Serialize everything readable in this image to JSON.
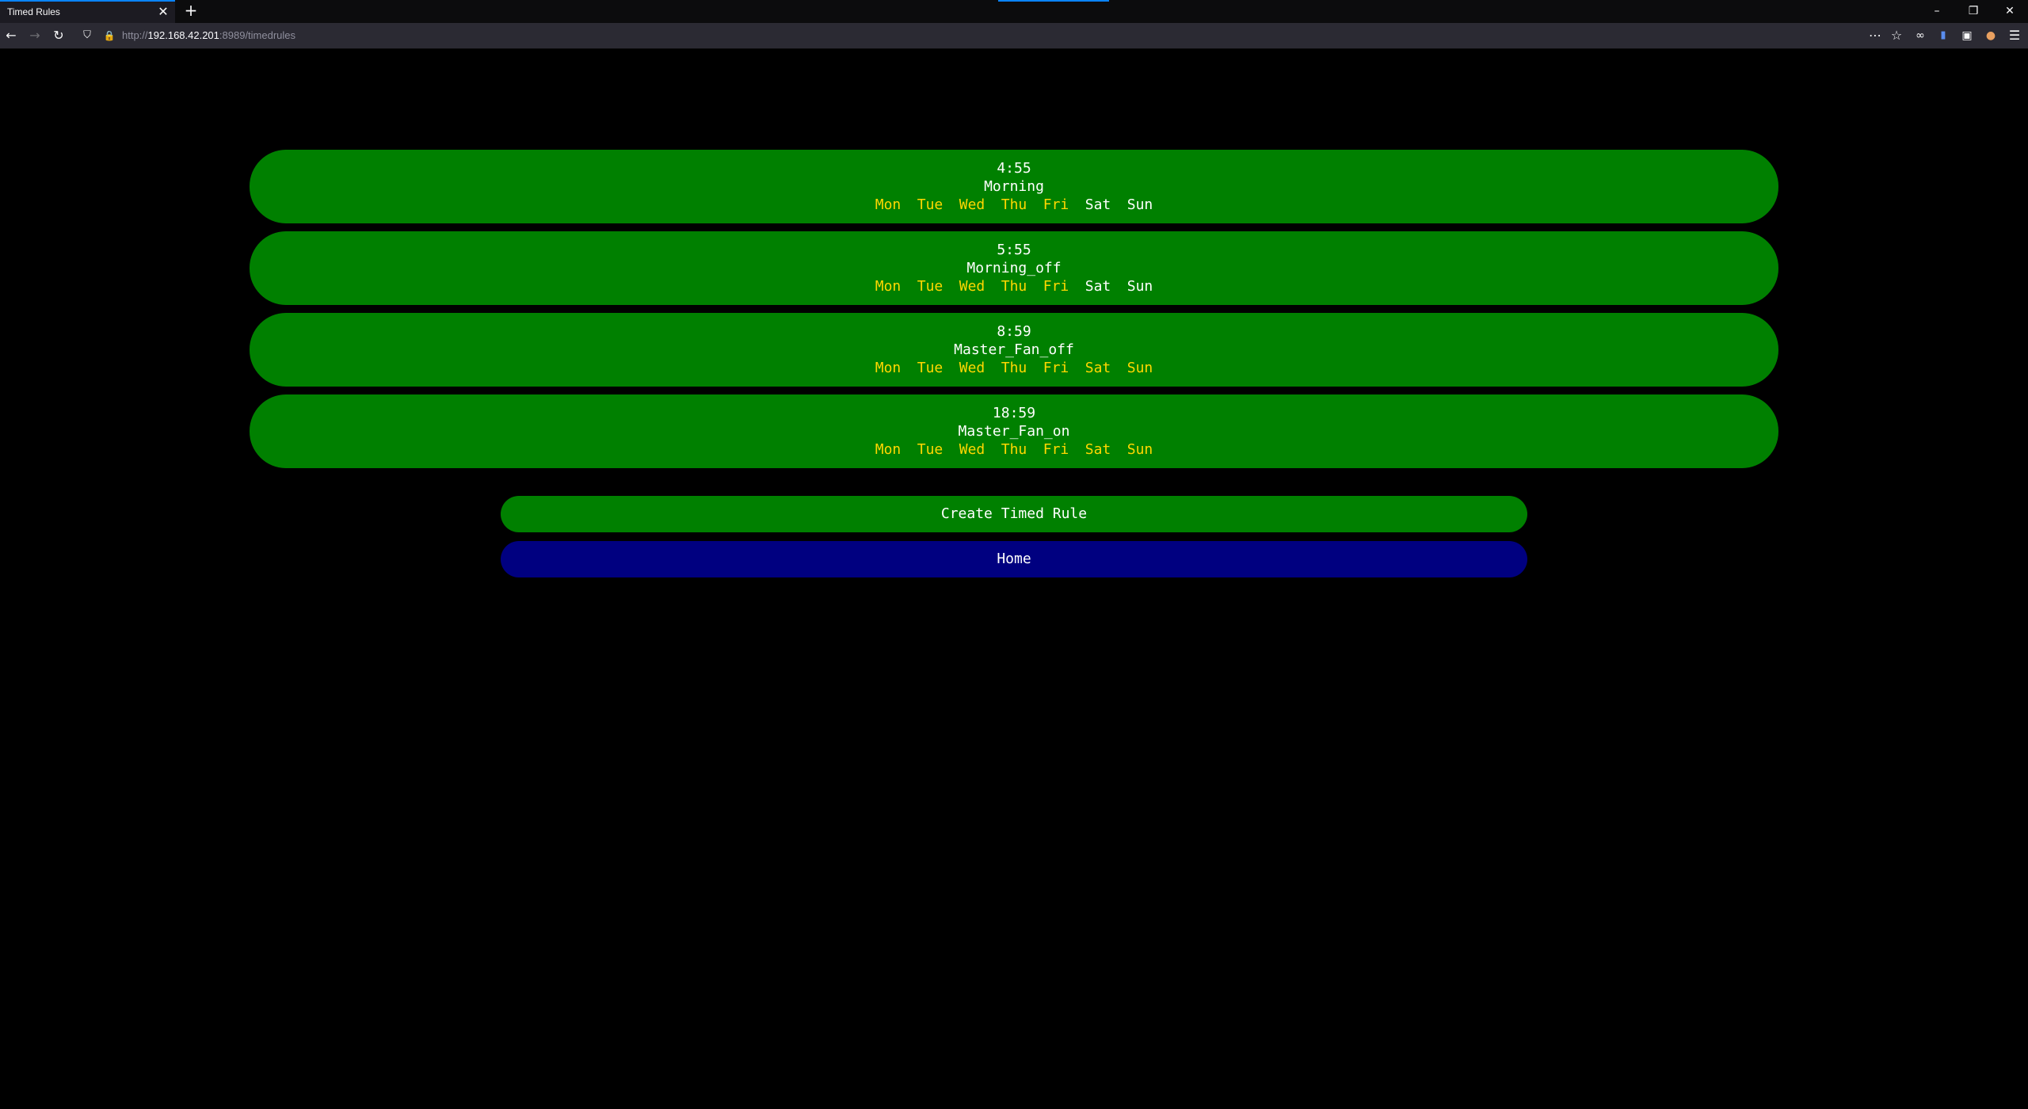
{
  "browser": {
    "tab_title": "Timed Rules",
    "tab_close": "✕",
    "new_tab": "+",
    "url_host": "192.168.42.201",
    "url_scheme": "http://",
    "url_rest": ":8989/timedrules",
    "window_controls": [
      "–",
      "❐",
      "✕"
    ]
  },
  "rules": [
    {
      "time": "4:55",
      "name": "Morning",
      "days": [
        "Mon",
        "Tue",
        "Wed",
        "Thu",
        "Fri",
        "Sat",
        "Sun"
      ],
      "selected": [
        true,
        true,
        true,
        true,
        true,
        false,
        false
      ]
    },
    {
      "time": "5:55",
      "name": "Morning_off",
      "days": [
        "Mon",
        "Tue",
        "Wed",
        "Thu",
        "Fri",
        "Sat",
        "Sun"
      ],
      "selected": [
        true,
        true,
        true,
        true,
        true,
        false,
        false
      ]
    },
    {
      "time": "8:59",
      "name": "Master_Fan_off",
      "days": [
        "Mon",
        "Tue",
        "Wed",
        "Thu",
        "Fri",
        "Sat",
        "Sun"
      ],
      "selected": [
        true,
        true,
        true,
        true,
        true,
        true,
        true
      ]
    },
    {
      "time": "18:59",
      "name": "Master_Fan_on",
      "days": [
        "Mon",
        "Tue",
        "Wed",
        "Thu",
        "Fri",
        "Sat",
        "Sun"
      ],
      "selected": [
        true,
        true,
        true,
        true,
        true,
        true,
        true
      ]
    }
  ],
  "actions": {
    "create_label": "Create Timed Rule",
    "home_label": "Home"
  },
  "colors": {
    "rule_bg": "#008000",
    "home_bg": "#000080",
    "selected_day": "#ffd700",
    "unselected_day": "#ffffff"
  }
}
